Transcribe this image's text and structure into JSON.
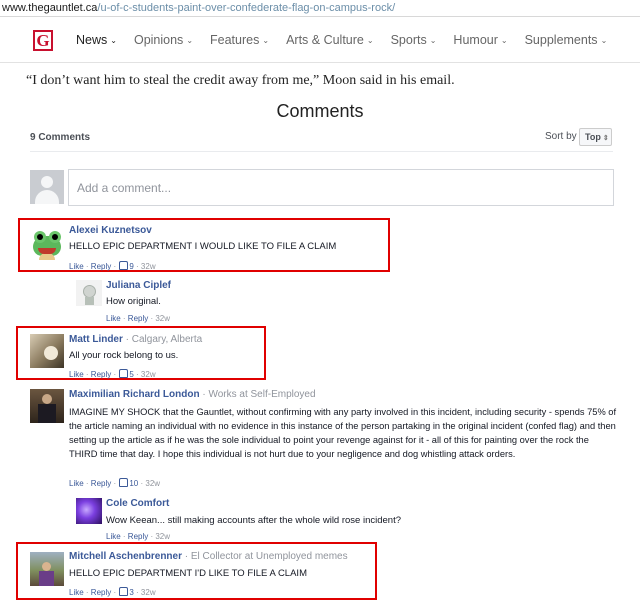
{
  "browser": {
    "url_domain": "www.thegauntlet.ca",
    "url_path": "/u-of-c-students-paint-over-confederate-flag-on-campus-rock/"
  },
  "nav": {
    "logo_letter": "G",
    "items": [
      {
        "label": "News"
      },
      {
        "label": "Opinions"
      },
      {
        "label": "Features"
      },
      {
        "label": "Arts & Culture"
      },
      {
        "label": "Sports"
      },
      {
        "label": "Humour"
      },
      {
        "label": "Supplements"
      }
    ],
    "chevron": "⌄"
  },
  "article": {
    "quote": "“I don’t want him to steal the credit away from me,” Moon said in his email."
  },
  "comments": {
    "title": "Comments",
    "count_label": "9 Comments",
    "sort_label": "Sort by",
    "sort_value": "Top",
    "add_placeholder": "Add a comment...",
    "actions": {
      "like": "Like",
      "reply": "Reply",
      "separator": " · "
    },
    "highlight_color": "#e00000",
    "items": [
      {
        "name": "Alexei Kuznetsov",
        "meta": "",
        "text": "HELLO EPIC DEPARTMENT I WOULD LIKE TO FILE A CLAIM",
        "likes": "9",
        "age": "32w"
      },
      {
        "name": "Juliana Ciplef",
        "meta": "",
        "text": "How original.",
        "likes": "",
        "age": "32w"
      },
      {
        "name": "Matt Linder",
        "meta": " · Calgary, Alberta",
        "text": "All your rock belong to us.",
        "likes": "5",
        "age": "32w"
      },
      {
        "name": "Maximilian Richard London",
        "meta": " · Works at Self-Employed",
        "text": "IMAGINE MY SHOCK that the Gauntlet, without confirming with any party involved in this incident, including security - spends 75% of the article naming an individual with no evidence in this instance of the person partaking in the original incident (confed flag) and then setting up the article as if he was the sole individual to point your revenge against for it - all of this for painting over the rock the THIRD time that day. I hope this individual is not hurt due to your negligence and dog whistling attack orders.",
        "likes": "10",
        "age": "32w"
      },
      {
        "name": "Cole Comfort",
        "meta": "",
        "text": "Wow Keean... still making accounts after the whole wild rose incident?",
        "likes": "",
        "age": "32w"
      },
      {
        "name": "Mitchell Aschenbrenner",
        "meta": " · El Collector at Unemployed memes",
        "text": "HELLO EPIC DEPARTMENT I'D LIKE TO FILE A CLAIM",
        "likes": "3",
        "age": "32w"
      }
    ]
  }
}
